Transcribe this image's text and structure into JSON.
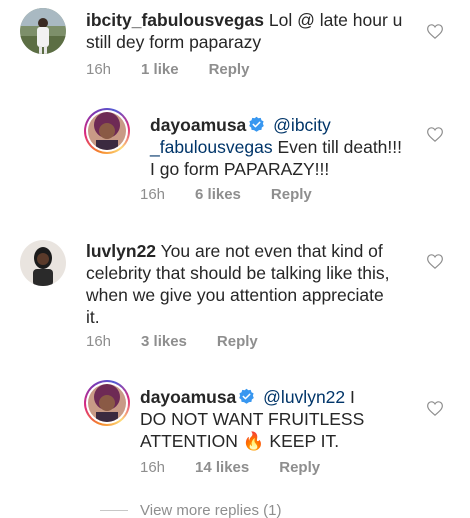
{
  "comments": [
    {
      "username": "ibcity_fabulousvegas",
      "mention": "",
      "text_lines": [
        "Lol @ late hour  u",
        "still dey form paparazy"
      ],
      "time": "16h",
      "likes": "1 like",
      "reply": "Reply",
      "verified": false
    },
    {
      "username": "dayoamusa",
      "mention_lines": [
        "@ibcity",
        "_fabulousvegas"
      ],
      "text_lines": [
        "Even till death!!!",
        "I go form PAPARAZY!!!"
      ],
      "time": "16h",
      "likes": "6 likes",
      "reply": "Reply",
      "verified": true
    },
    {
      "username": "luvlyn22",
      "text_lines": [
        "You are not even that kind of",
        "celebrity that should be talking like this,",
        "when we give you attention appreciate",
        "it."
      ],
      "time": "16h",
      "likes": "3 likes",
      "reply": "Reply",
      "verified": false
    },
    {
      "username": "dayoamusa",
      "mention": "@luvlyn22",
      "text_lines": [
        "I",
        "DO NOT WANT FRUITLESS",
        "ATTENTION",
        "KEEP IT."
      ],
      "emoji": "🔥",
      "time": "16h",
      "likes": "14 likes",
      "reply": "Reply",
      "verified": true
    }
  ],
  "view_more": "View more replies (1)",
  "icons": {
    "like": "heart-outline-icon",
    "verified": "verified-badge-icon",
    "fire": "fire-emoji-icon"
  },
  "colors": {
    "verified": "#3897f0",
    "meta": "#8e8e8e",
    "mention": "#003569"
  }
}
